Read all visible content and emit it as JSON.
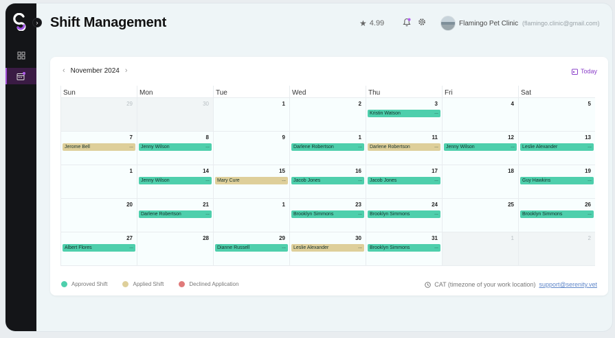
{
  "header": {
    "title": "Shift Management",
    "rating": "4.99",
    "clinic_name": "Flamingo Pet Clinic",
    "clinic_email": "(flamingo.clinic@gmail.com)"
  },
  "calendar": {
    "month_label": "November 2024",
    "today_label": "Today",
    "weekdays": [
      "Sun",
      "Mon",
      "Tue",
      "Wed",
      "Thu",
      "Fri",
      "Sat"
    ],
    "weeks": [
      [
        {
          "day": "29",
          "muted": true
        },
        {
          "day": "30",
          "muted": true
        },
        {
          "day": "1"
        },
        {
          "day": "2"
        },
        {
          "day": "3",
          "event": {
            "name": "Kristin Watson",
            "status": "approved"
          }
        },
        {
          "day": "4"
        },
        {
          "day": "5"
        }
      ],
      [
        {
          "day": "7",
          "event": {
            "name": "Jerome Bell",
            "status": "applied"
          }
        },
        {
          "day": "8",
          "event": {
            "name": "Jenny Wilson",
            "status": "approved"
          }
        },
        {
          "day": "9"
        },
        {
          "day": "1",
          "event": {
            "name": "Darlene Robertson",
            "status": "approved"
          }
        },
        {
          "day": "11",
          "event": {
            "name": "Darlene Robertson",
            "status": "applied"
          }
        },
        {
          "day": "12",
          "event": {
            "name": "Jenny Wilson",
            "status": "approved"
          }
        },
        {
          "day": "13",
          "event": {
            "name": "Leslie Alexander",
            "status": "approved"
          }
        }
      ],
      [
        {
          "day": "1"
        },
        {
          "day": "14",
          "event": {
            "name": "Jenny Wilson",
            "status": "approved"
          }
        },
        {
          "day": "15",
          "event": {
            "name": "Mary Cure",
            "status": "applied"
          }
        },
        {
          "day": "16",
          "event": {
            "name": "Jacob Jones",
            "status": "approved"
          }
        },
        {
          "day": "17",
          "event": {
            "name": "Jacob Jones",
            "status": "approved"
          }
        },
        {
          "day": "18"
        },
        {
          "day": "19",
          "event": {
            "name": "Guy Hawkins",
            "status": "approved"
          }
        }
      ],
      [
        {
          "day": "20"
        },
        {
          "day": "21",
          "event": {
            "name": "Darlene Robertson",
            "status": "approved"
          }
        },
        {
          "day": "1"
        },
        {
          "day": "23",
          "event": {
            "name": "Brooklyn Simmons",
            "status": "approved"
          }
        },
        {
          "day": "24",
          "event": {
            "name": "Brooklyn Simmons",
            "status": "approved"
          }
        },
        {
          "day": "25"
        },
        {
          "day": "26",
          "event": {
            "name": "Brooklyn Simmons",
            "status": "approved"
          }
        }
      ],
      [
        {
          "day": "27",
          "event": {
            "name": "Albert Flores",
            "status": "approved"
          }
        },
        {
          "day": "28"
        },
        {
          "day": "29",
          "event": {
            "name": "Dianne Russell",
            "status": "approved"
          }
        },
        {
          "day": "30",
          "event": {
            "name": "Leslie Alexander",
            "status": "applied"
          }
        },
        {
          "day": "31",
          "event": {
            "name": "Brooklyn Simmons",
            "status": "approved"
          }
        },
        {
          "day": "1",
          "muted": true
        },
        {
          "day": "2",
          "muted": true
        }
      ]
    ],
    "event_more": "..."
  },
  "legend": {
    "approved": "Approved Shift",
    "applied": "Applied Shift",
    "declined": "Declined Application",
    "colors": {
      "approved": "#4ecfac",
      "applied": "#decf9a",
      "declined": "#e07a7a"
    }
  },
  "footer": {
    "timezone": "CAT (timezone of your work location)",
    "support_email": "support@serenity.vet"
  }
}
